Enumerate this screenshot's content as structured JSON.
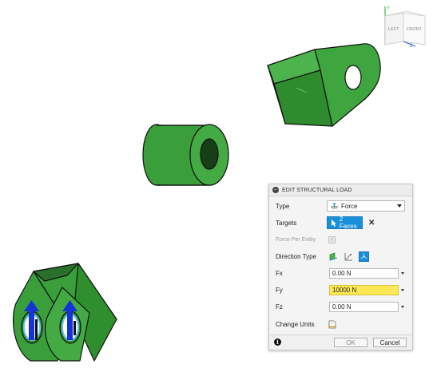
{
  "viewcube": {
    "left_label": "LEFT",
    "front_label": "FRONT",
    "axis_y": "Y",
    "axis_z": "Z"
  },
  "dialog": {
    "title": "EDIT STRUCTURAL LOAD",
    "type_label": "Type",
    "type_value": "Force",
    "targets_label": "Targets",
    "targets_button": "2 Faces",
    "force_per_entity_label": "Force Per Entity",
    "force_per_entity_checked": true,
    "direction_type_label": "Direction Type",
    "direction_options": [
      "angle-icon",
      "vectors-icon",
      "components-icon"
    ],
    "direction_selected": "components-icon",
    "fx_label": "Fx",
    "fx_value": "0.00 N",
    "fy_label": "Fy",
    "fy_value": "10000 N",
    "fz_label": "Fz",
    "fz_value": "0.00 N",
    "change_units_label": "Change Units",
    "ok_label": "OK",
    "cancel_label": "Cancel"
  },
  "colors": {
    "model_green": "#3a9e3a",
    "highlight": "#fbe854",
    "accent": "#1a8fd9"
  }
}
